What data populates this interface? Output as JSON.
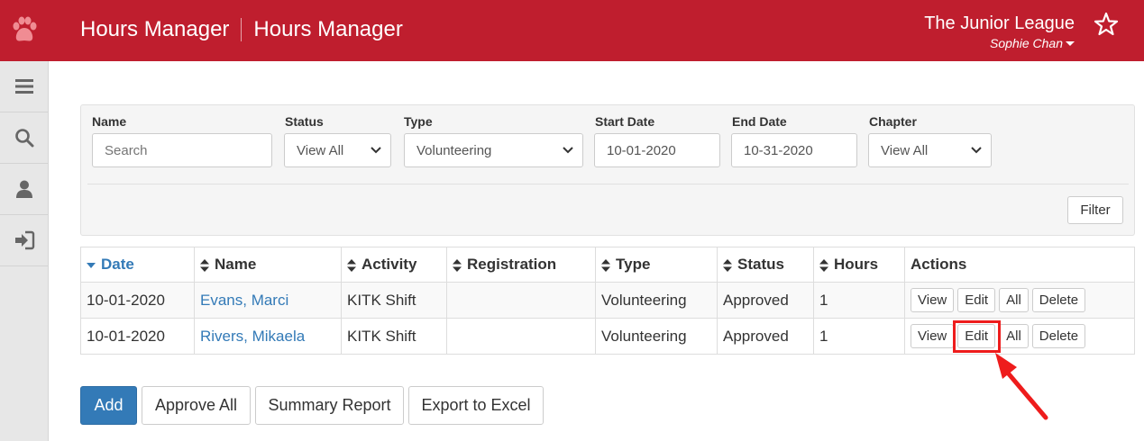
{
  "header": {
    "app_title": "Hours Manager",
    "page_title": "Hours Manager",
    "org_name": "The Junior League",
    "user_name": "Sophie Chan",
    "brand_color": "#bf1e2e"
  },
  "sidebar": {
    "items": [
      {
        "icon": "menu-icon"
      },
      {
        "icon": "search-icon"
      },
      {
        "icon": "user-icon"
      },
      {
        "icon": "sign-out-icon"
      }
    ]
  },
  "filters": {
    "name": {
      "label": "Name",
      "placeholder": "Search"
    },
    "status": {
      "label": "Status",
      "value": "View All"
    },
    "type": {
      "label": "Type",
      "value": "Volunteering"
    },
    "start_date": {
      "label": "Start Date",
      "value": "10-01-2020"
    },
    "end_date": {
      "label": "End Date",
      "value": "10-31-2020"
    },
    "chapter": {
      "label": "Chapter",
      "value": "View All"
    },
    "filter_button": "Filter"
  },
  "table": {
    "columns": [
      "Date",
      "Name",
      "Activity",
      "Registration",
      "Type",
      "Status",
      "Hours",
      "Actions"
    ],
    "rows": [
      {
        "date": "10-01-2020",
        "name": "Evans, Marci",
        "activity": "KITK Shift",
        "registration": "",
        "type": "Volunteering",
        "status": "Approved",
        "hours": "1"
      },
      {
        "date": "10-01-2020",
        "name": "Rivers, Mikaela",
        "activity": "KITK Shift",
        "registration": "",
        "type": "Volunteering",
        "status": "Approved",
        "hours": "1"
      }
    ],
    "row_actions": {
      "view": "View",
      "edit": "Edit",
      "all": "All",
      "delete": "Delete"
    }
  },
  "bottom_buttons": {
    "add": "Add",
    "approve_all": "Approve All",
    "summary_report": "Summary Report",
    "export_excel": "Export to Excel"
  },
  "annotation": {
    "color": "#ee1c1c"
  }
}
